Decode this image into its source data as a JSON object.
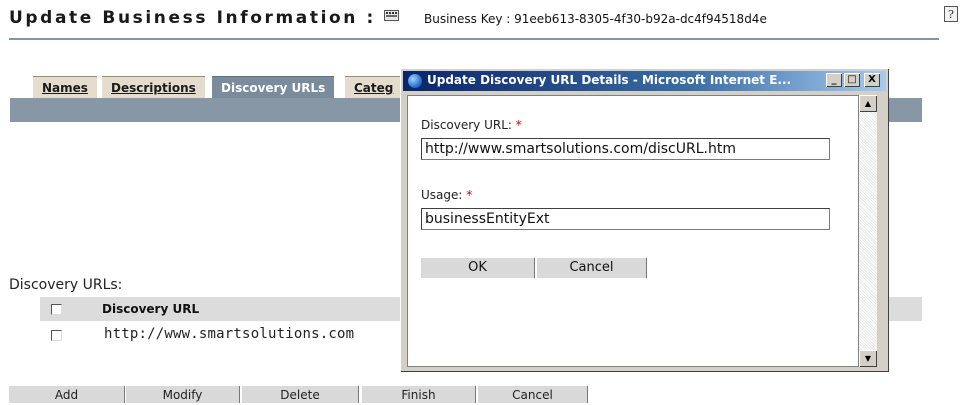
{
  "header": {
    "title": "Update Business Information :",
    "business_key_label": "Business Key : 91eeb613-8305-4f30-b92a-dc4f94518d4e",
    "help_icon": "help-icon",
    "help_glyph": "?"
  },
  "tabs": [
    {
      "label": "Names",
      "active": false
    },
    {
      "label": "Descriptions",
      "active": false
    },
    {
      "label": "Discovery URLs",
      "active": true
    },
    {
      "label": "Categ",
      "active": false
    }
  ],
  "discovery": {
    "section_label": "Discovery URLs:",
    "column_header": "Discovery URL",
    "rows": [
      {
        "url": "http://www.smartsolutions.com",
        "checked": false
      }
    ]
  },
  "actions": [
    "Add",
    "Modify",
    "Delete",
    "Finish",
    "Cancel"
  ],
  "dialog": {
    "title": "Update Discovery URL Details - Microsoft Internet E...",
    "window_controls": [
      "_",
      "□",
      "X"
    ],
    "url_label": "Discovery URL:",
    "url_value": "http://www.smartsolutions.com/discURL.htm",
    "usage_label": "Usage:",
    "usage_value": "businessEntityExt",
    "required_marker": "*",
    "ok_label": "OK",
    "cancel_label": "Cancel"
  },
  "colors": {
    "tab_bar": "#8797a6",
    "tab_inactive": "#e4dccc",
    "required": "#d00000",
    "dialog_titlebar": "#0a246a"
  }
}
